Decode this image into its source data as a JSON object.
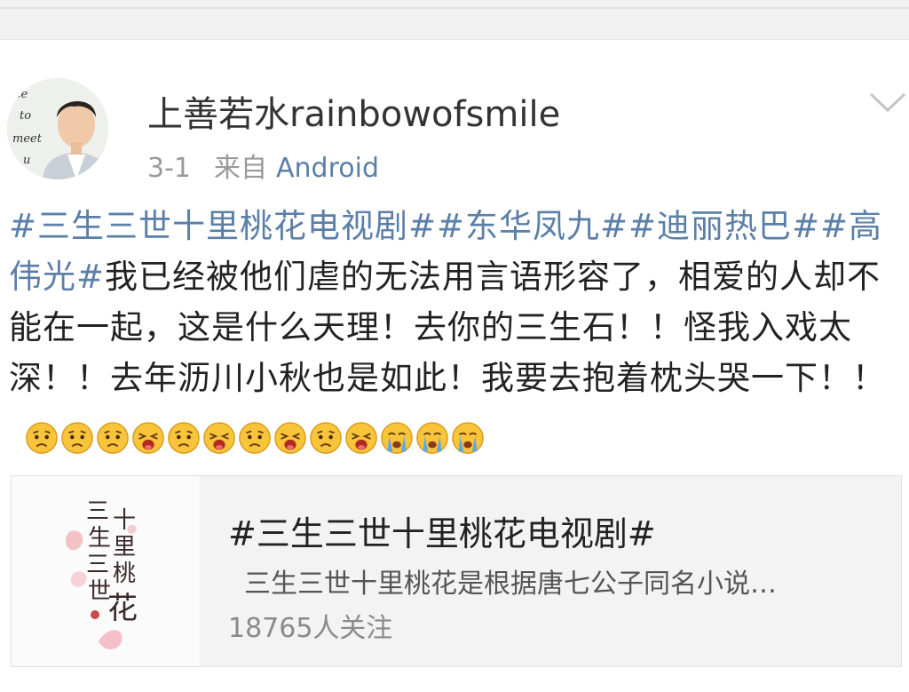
{
  "post": {
    "username": "上善若水rainbowofsmile",
    "time": "3-1",
    "from_label": "来自",
    "source": "Android",
    "avatar_text": [
      "ice",
      "to",
      "meet",
      "u"
    ],
    "tags_line": "#三生三世十里桃花电视剧##东华凤九##迪丽热巴##高伟光#",
    "body_text": "我已经被他们虐的无法用言语形容了，相爱的人却不能在一起，这是什么天理！去你的三生石！！怪我入戏太深！！去年沥川小秋也是如此！我要去抱着枕头哭一下！！",
    "emojis": [
      "sad-face",
      "sad-face",
      "sad-face",
      "crying-face",
      "sad-face",
      "crying-face",
      "sad-face",
      "crying-face",
      "sad-face",
      "crying-face",
      "tearful-face",
      "tearful-face",
      "tearful-face"
    ]
  },
  "card": {
    "title": "#三生三世十里桃花电视剧#",
    "description": "三生三世十里桃花是根据唐七公子同名小说…",
    "followers": "18765人关注",
    "thumb_text": [
      "三",
      "生",
      "三",
      "世",
      "十",
      "里",
      "桃",
      "花"
    ]
  },
  "colors": {
    "link": "#5b7fa8",
    "text": "#222222",
    "meta": "#9a9a9a"
  }
}
